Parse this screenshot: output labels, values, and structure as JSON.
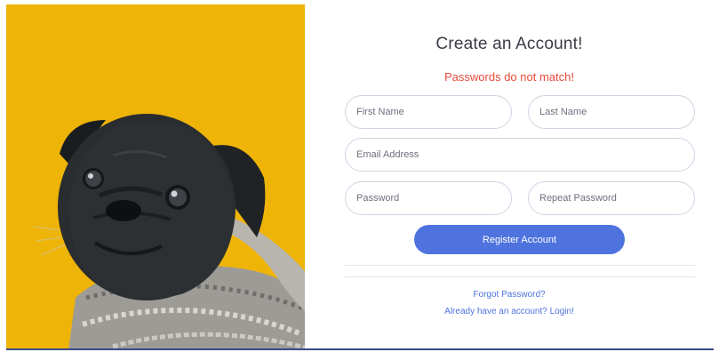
{
  "image_panel": {
    "background_color": "#efb408",
    "subject": "pug-in-knitted-sweater"
  },
  "form": {
    "title": "Create an Account!",
    "error_message": "Passwords do not match!",
    "fields": {
      "first_name": {
        "placeholder": "First Name",
        "value": ""
      },
      "last_name": {
        "placeholder": "Last Name",
        "value": ""
      },
      "email": {
        "placeholder": "Email Address",
        "value": ""
      },
      "password": {
        "placeholder": "Password",
        "value": ""
      },
      "repeat_password": {
        "placeholder": "Repeat Password",
        "value": ""
      }
    },
    "register_label": "Register Account",
    "forgot_password_label": "Forgot Password?",
    "login_label": "Already have an account? Login!"
  },
  "colors": {
    "primary": "#4e73df",
    "error": "#e74a3b",
    "title_text": "#3a3b45",
    "field_border": "#d1d3e2"
  }
}
